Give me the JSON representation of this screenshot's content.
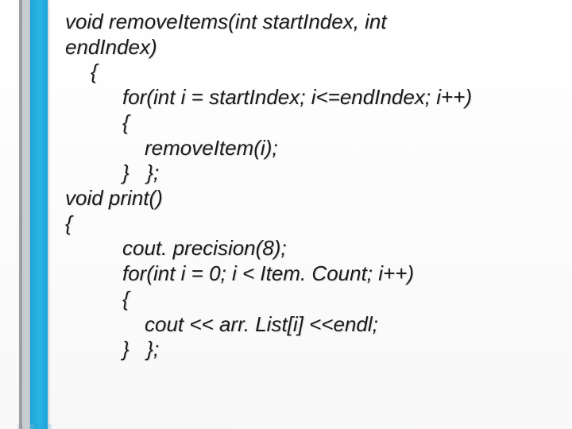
{
  "code": {
    "l1": "void removeItems(int startIndex, int",
    "l2": "endIndex)",
    "l3": "{",
    "l4": "for(int i = startIndex; i<=endIndex; i++)",
    "l5": "{",
    "l6": "removeItem(i);",
    "l7": "}   };",
    "l8": "void print()",
    "l9": "{",
    "l10": "cout. precision(8);",
    "l11": "for(int i = 0; i < Item. Count; i++)",
    "l12": "{",
    "l13": "cout << arr. List[i] <<endl;",
    "l14": "}   };"
  }
}
